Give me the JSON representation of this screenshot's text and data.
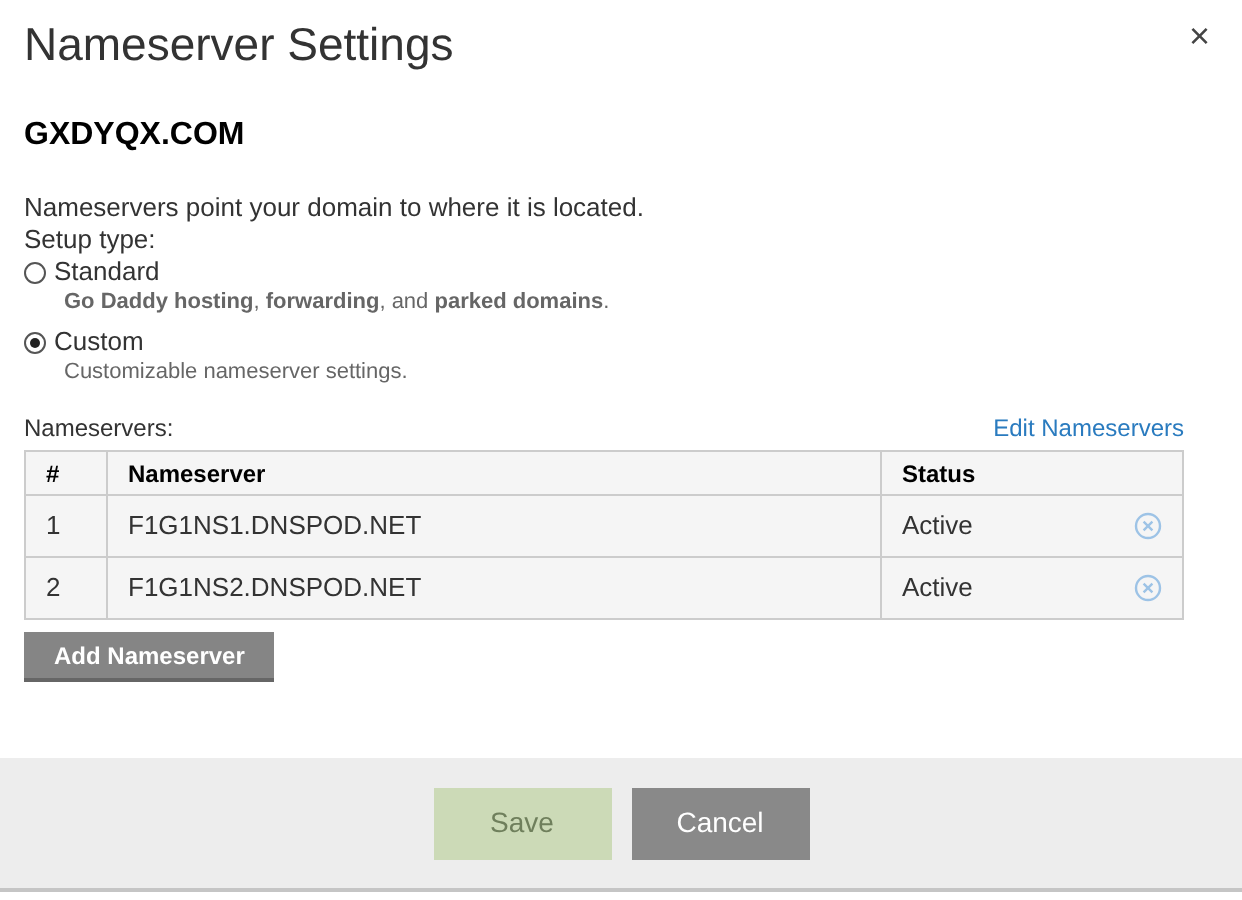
{
  "dialog": {
    "title": "Nameserver Settings",
    "close": "×"
  },
  "domain": "GXDYQX.COM",
  "intro": "Nameservers point your domain to where it is located.",
  "setup_label": "Setup type:",
  "setup_options": [
    {
      "label": "Standard",
      "description": "**Go Daddy hosting**, **forwarding**, and **parked domains**.",
      "selected": false
    },
    {
      "label": "Custom",
      "description": "Customizable nameserver settings.",
      "selected": true
    }
  ],
  "nameservers_label": "Nameservers:",
  "edit_link": "Edit Nameservers",
  "table": {
    "columns": [
      "#",
      "Nameserver",
      "Status"
    ],
    "rows": [
      {
        "index": "1",
        "nameserver": "F1G1NS1.DNSPOD.NET",
        "status": "Active"
      },
      {
        "index": "2",
        "nameserver": "F1G1NS2.DNSPOD.NET",
        "status": "Active"
      }
    ]
  },
  "add_button": "Add Nameserver",
  "footer": {
    "buttons": [
      {
        "label": "Save",
        "kind": "primary",
        "disabled": true
      },
      {
        "label": "Cancel",
        "kind": "secondary",
        "disabled": false
      }
    ]
  }
}
